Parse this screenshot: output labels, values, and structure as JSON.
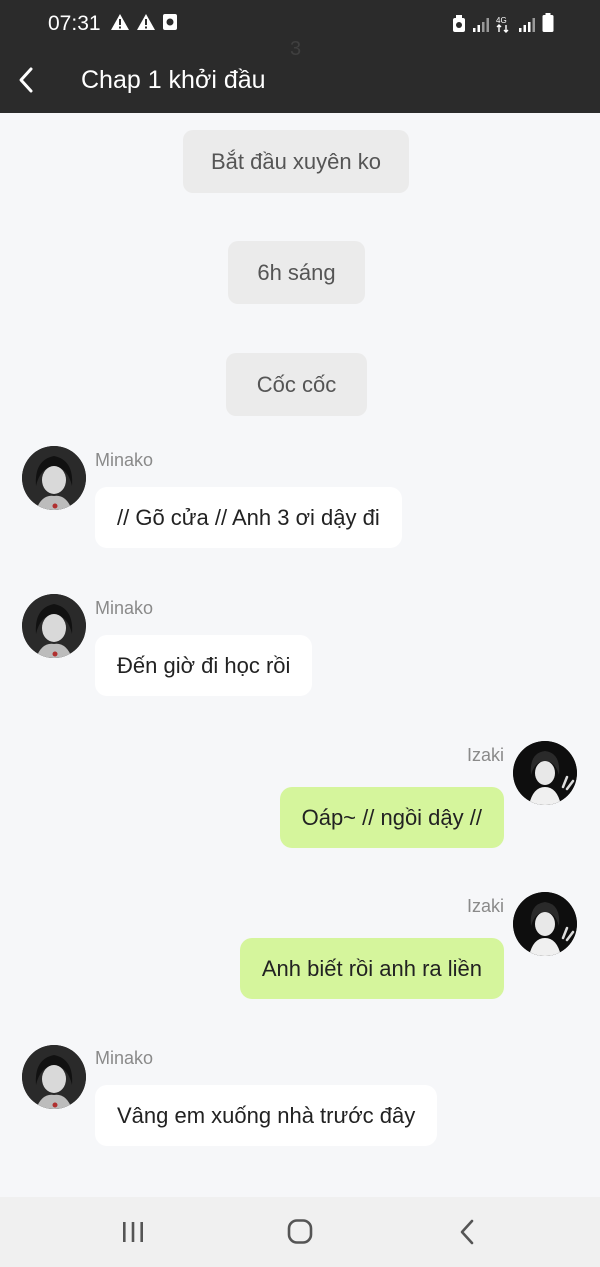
{
  "status_bar": {
    "time": "07:31",
    "ghost_number": "3",
    "left_icons": [
      "warning-icon",
      "warning-icon",
      "screen-record-icon"
    ],
    "right_icons": [
      "battery-saver-icon",
      "signal-icon",
      "4g-icon",
      "signal-icon",
      "battery-icon"
    ]
  },
  "header": {
    "title": "Chap 1 khởi đầu",
    "back_icon": "chevron-left-icon"
  },
  "chat": {
    "notices": [
      "Bắt đầu xuyên ko",
      "6h sáng",
      "Cốc cốc"
    ],
    "messages": [
      {
        "sender": "Minako",
        "side": "left",
        "text": "// Gõ cửa // Anh 3 ơi dậy đi"
      },
      {
        "sender": "Minako",
        "side": "left",
        "text": "Đến giờ đi học rồi"
      },
      {
        "sender": "Izaki",
        "side": "right",
        "text": "Oáp~ // ngồi dậy //"
      },
      {
        "sender": "Izaki",
        "side": "right",
        "text": "Anh biết rồi anh ra liền"
      },
      {
        "sender": "Minako",
        "side": "left",
        "text": "Vâng em xuống nhà trước đây"
      }
    ]
  },
  "colors": {
    "header_bg": "#2b2b2b",
    "chat_bg": "#f6f7f9",
    "incoming_bubble": "#ffffff",
    "outgoing_bubble": "#d5f59c",
    "notice_bg": "#ebebeb"
  },
  "nav_bar": {
    "icons": [
      "recent-apps-icon",
      "home-icon",
      "back-icon"
    ]
  }
}
